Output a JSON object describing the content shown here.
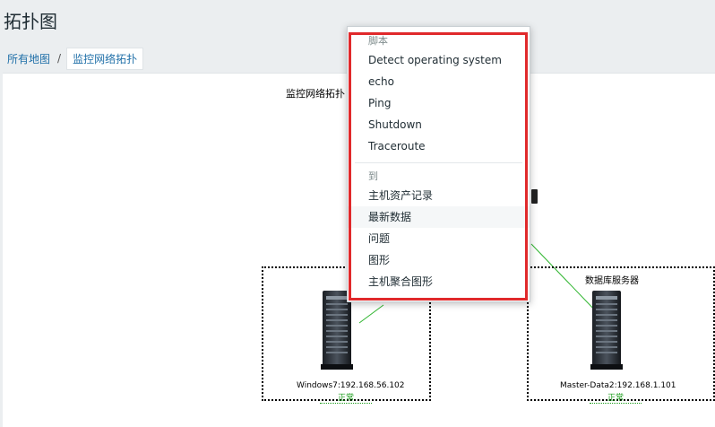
{
  "page": {
    "title": "拓扑图"
  },
  "breadcrumb": {
    "root": "所有地图",
    "separator": "/",
    "current": "监控网络拓扑"
  },
  "map": {
    "title": "监控网络拓扑",
    "hosts": [
      {
        "label": "Windows7:192.168.56.102",
        "status": "正常"
      },
      {
        "name": "数据库服务器",
        "label": "Master-Data2:192.168.1.101",
        "status": "正常"
      }
    ],
    "link_color": "#2fb52f"
  },
  "context_menu": {
    "section_scripts": "脚本",
    "scripts": [
      "Detect operating system",
      "echo",
      "Ping",
      "Shutdown",
      "Traceroute"
    ],
    "section_goto": "到",
    "goto": [
      "主机资产记录",
      "最新数据",
      "问题",
      "图形",
      "主机聚合图形"
    ],
    "highlight_color": "#e0292b"
  }
}
